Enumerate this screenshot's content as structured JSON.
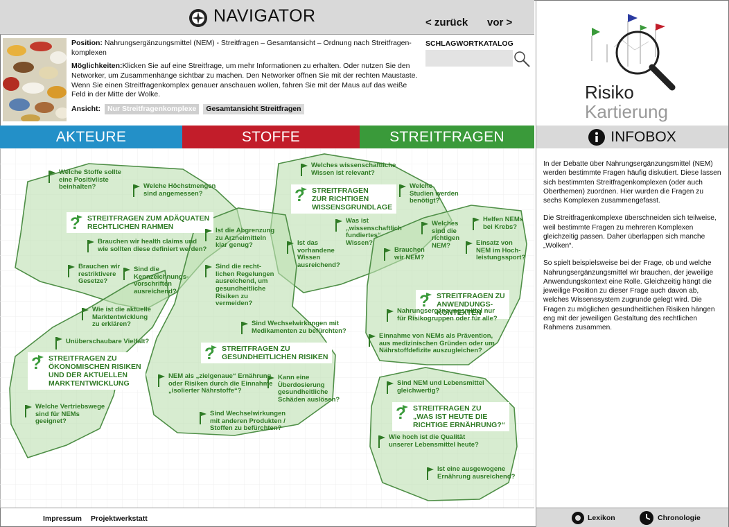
{
  "navigator": {
    "title": "NAVIGATOR",
    "back": "< zurück",
    "forward": "vor >",
    "position_label": "Position:",
    "position_text": "Nahrungsergänzungsmittel (NEM) - Streitfragen – Gesamtansicht – Ordnung nach Streitfragen-komplexen",
    "possibilities_label": "Möglichkeiten:",
    "possibilities_text": "Klicken Sie auf eine Streitfrage, um mehr Informationen zu erhalten. Oder nutzen Sie den Networker, um Zusammenhänge sichtbar zu machen. Den Networker öffnen Sie mit der rechten Maustaste. Wenn Sie einen Streitfragenkomplex genauer anschauen wollen, fahren Sie mit der Maus auf das weiße Feld in der Mitte der Wolke.",
    "view_label": "Ansicht:",
    "view_options": [
      "Nur Streitfragenkomplexe",
      "Gesamtansicht Streitfragen"
    ],
    "keyword_label": "SCHLAGWORTKATALOG"
  },
  "brand": {
    "line1": "Risiko",
    "line2": "Kartierung"
  },
  "tabs": [
    "AKTEURE",
    "STOFFE",
    "STREITFRAGEN"
  ],
  "infobox": {
    "title": "INFOBOX",
    "paragraphs": [
      "In der Debatte über Nahrungsergänzungsmittel (NEM) werden bestimmte Fragen häufig diskutiert. Diese lassen sich bestimmten Streitfragenkomplexen (oder auch Oberthemen) zuordnen. Hier wurden die Fragen zu sechs Komplexen zusammengefasst.",
      "Die Streitfragenkomplexe überschneiden sich teilweise, weil bestimmte Fragen zu mehreren Komplexen gleichzeitig passen. Daher überlappen sich manche „Wolken“.",
      "So spielt beispielsweise bei der Frage, ob und welche Nahrungsergänzungsmittel wir brauchen, der jeweilige Anwendungskontext eine Rolle. Gleichzeitig hängt die jeweilige Position zu dieser Frage auch davon ab, welches Wissenssystem zugrunde gelegt wird. Die Fragen zu möglichen gesundheitlichen Risiken hängen eng mit der jeweiligen Gestaltung des rechtlichen Rahmens zusammen."
    ]
  },
  "footer": {
    "links": [
      "Impressum",
      "Projektwerkstatt"
    ],
    "right": [
      "Lexikon",
      "Chronologie"
    ]
  },
  "map": {
    "headings": [
      "STREITFRAGEN ZUM ADÄQUATEN\nRECHTLICHEN RAHMEN",
      "STREITFRAGEN\nZUR RICHTIGEN\nWISSENSGRUNDLAGE",
      "STREITFRAGEN ZU\nANWENDUNGS-\nKONTEXTEN",
      "STREITFRAGEN ZU\nGESUNDHEITLICHEN RISIKEN",
      "STREITFRAGEN ZU\nÖKONOMISCHEN RISIKEN\nUND DER AKTUELLEN\nMARKTENTWICKLUNG",
      "STREITFRAGEN ZU\n„WAS IST HEUTE DIE\nRICHTIGE ERNÄHRUNG?“"
    ],
    "questions": [
      "Welche Stoffe sollte\neine Positivliste\nbeinhalten?",
      "Welche Höchstmengen\nsind angemessen?",
      "Brauchen wir health claims und\nwie sollten diese definiert werden?",
      "Brauchen wir\nrestriktivere\nGesetze?",
      "Sind die\nKennzeichnungs-\nvorschriften\nausreichend?",
      "Welches wissenschaftliche\nWissen ist relevant?",
      "Welche\nStudien werden\nbenötigt?",
      "Was ist\n„wissenschaftlich\nfundiertes“\nWissen?",
      "Ist das\nvorhandene\nWissen\nausreichend?",
      "Ist die Abgrenzung\nzu Arzneimitteln\nklar genug?",
      "Sind die recht-\nlichen Regelungen\nausreichend, um\ngesundheitliche\nRisiken zu\nvermeiden?",
      "Welches\nsind die\nrichtigen\nNEM?",
      "Helfen NEMs\nbei Krebs?",
      "Einsatz von\nNEM im Hoch-\nleistungssport?",
      "Brauchen\nwir NEM?",
      "Nahrungsergänzungsmittel nur\nfür Risikogruppen oder für alle?",
      "Einnahme von NEMs als Prävention,\naus medizinischen Gründen oder um\nNährstoffdefizite auszugleichen?",
      "Wie ist die aktuelle\nMarktentwicklung\nzu erklären?",
      "Unüberschaubare Vielfalt?",
      "Welche Vertriebswege\nsind für NEMs\ngeeignet?",
      "Sind Wechselwirkungen mit\nMedikamenten zu befürchten?",
      "NEM als „zielgenaue“ Ernährung\noder Risiken durch die Einnahme\n„isolierter Nährstoffe“?",
      "Kann eine\nÜberdosierung\ngesundheitliche\nSchäden auslösen?",
      "Sind Wechselwirkungen\nmit anderen Produkten /\nStoffen zu befürchten?",
      "Sind NEM und Lebensmittel\ngleichwertig?",
      "Wie hoch ist die Qualität\nunserer Lebensmittel heute?",
      "Ist eine ausgewogene\nErnährung ausreichend?"
    ]
  },
  "colors": {
    "akteure": "#2390c8",
    "stoffe": "#c21d2a",
    "streitfragen": "#3a9a3a",
    "cloud_fill": "#bfe0b3",
    "cloud_stroke": "#4f8f47",
    "text_green": "#2f7a25"
  },
  "icons": [
    "navigator-compass-icon",
    "magnifier-icon",
    "info-icon",
    "question-icon",
    "flag-icon",
    "lexikon-icon",
    "clock-icon"
  ]
}
